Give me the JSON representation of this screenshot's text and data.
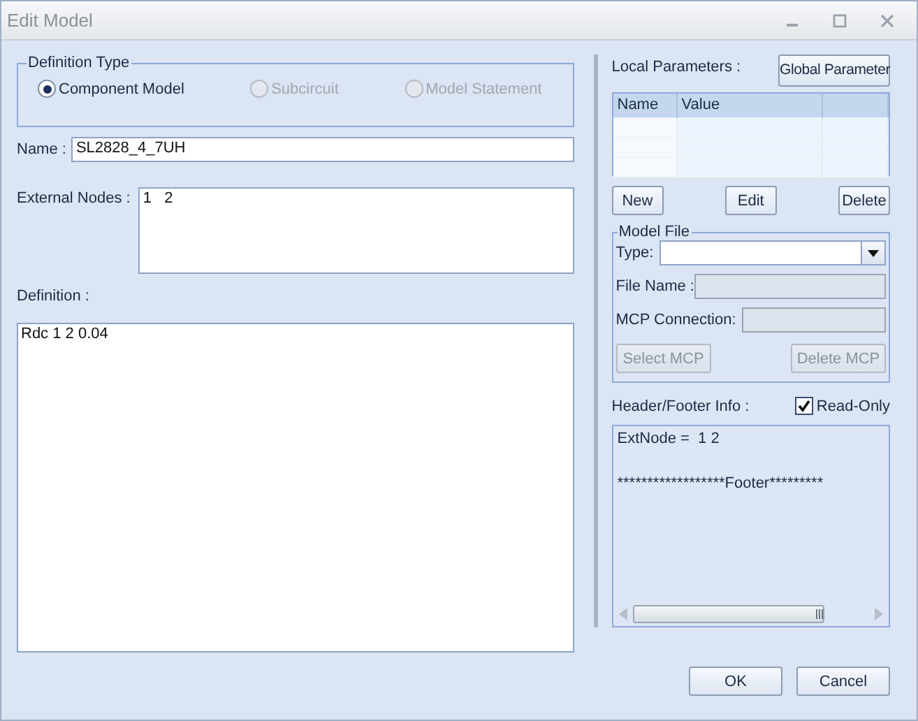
{
  "window": {
    "title": "Edit Model"
  },
  "definition_type": {
    "legend": "Definition Type",
    "options": [
      {
        "label": "Component Model",
        "selected": true,
        "disabled": false
      },
      {
        "label": "Subcircuit",
        "selected": false,
        "disabled": true
      },
      {
        "label": "Model Statement",
        "selected": false,
        "disabled": true
      }
    ]
  },
  "name": {
    "label": "Name :",
    "value": "SL2828_4_7UH"
  },
  "external_nodes": {
    "label": "External Nodes :",
    "value": "1   2"
  },
  "definition": {
    "label": "Definition :",
    "value": "Rdc 1 2 0.04"
  },
  "local_parameters": {
    "label": "Local Parameters :",
    "global_button": "Global Parameter",
    "columns": [
      "Name",
      "Value"
    ],
    "buttons": [
      {
        "label": "New"
      },
      {
        "label": "Edit"
      },
      {
        "label": "Delete"
      }
    ]
  },
  "model_file": {
    "legend": "Model File",
    "type_label": "Type:",
    "file_name_label": "File Name :",
    "mcp_label": "MCP Connection:",
    "buttons": [
      {
        "label": "Select MCP",
        "disabled": true
      },
      {
        "label": "Delete MCP",
        "disabled": true
      }
    ]
  },
  "header_footer": {
    "label": "Header/Footer Info :",
    "read_only": {
      "label": "Read-Only",
      "checked": true
    },
    "header_line": "ExtNode =  1 2",
    "footer_line": "******************Footer*********"
  },
  "buttons": [
    {
      "label": "OK"
    },
    {
      "label": "Cancel"
    }
  ]
}
